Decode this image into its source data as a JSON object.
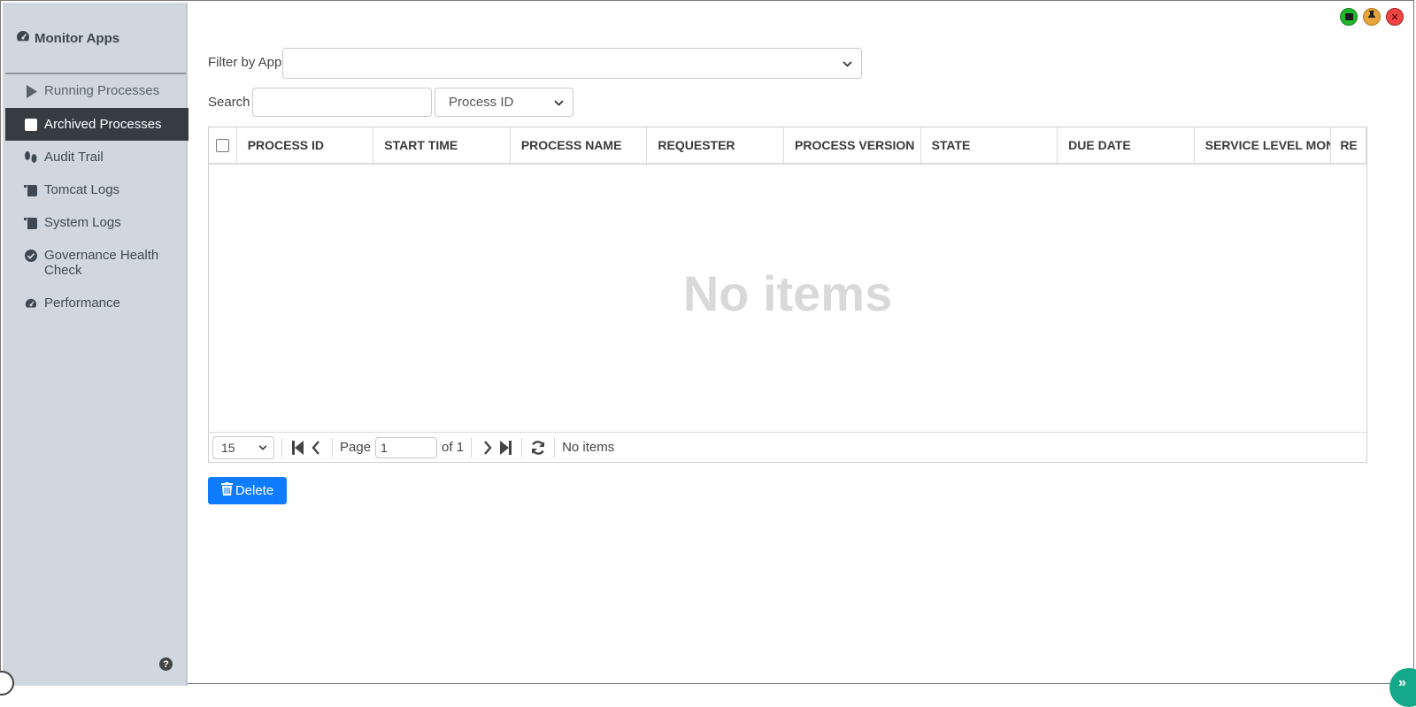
{
  "sidebar": {
    "brand": "Monitor Apps",
    "items": [
      {
        "label": "Running Processes",
        "icon": "play-icon"
      },
      {
        "label": "Archived Processes",
        "icon": "square-icon",
        "active": true
      },
      {
        "label": "Audit Trail",
        "icon": "footprints-icon"
      },
      {
        "label": "Tomcat Logs",
        "icon": "scroll-icon"
      },
      {
        "label": "System Logs",
        "icon": "scroll-icon"
      },
      {
        "label": "Governance Health Check",
        "icon": "check-circle-icon"
      },
      {
        "label": "Performance",
        "icon": "gauge-icon"
      }
    ],
    "help": "?"
  },
  "filter": {
    "label": "Filter by App",
    "value": ""
  },
  "search": {
    "label": "Search",
    "value": "",
    "field_select": "Process ID"
  },
  "table": {
    "columns": [
      "PROCESS ID",
      "START TIME",
      "PROCESS NAME",
      "REQUESTER",
      "PROCESS VERSION",
      "STATE",
      "DUE DATE",
      "SERVICE LEVEL MONITOR",
      "RE"
    ],
    "empty_message": "No items"
  },
  "pager": {
    "page_size": "15",
    "page_label": "Page",
    "page_value": "1",
    "of_label": "of 1",
    "status": "No items"
  },
  "actions": {
    "delete_label": "Delete"
  },
  "colors": {
    "sidebar_bg": "#d0d7de",
    "active_bg": "#353c42",
    "primary": "#0f7cff"
  }
}
